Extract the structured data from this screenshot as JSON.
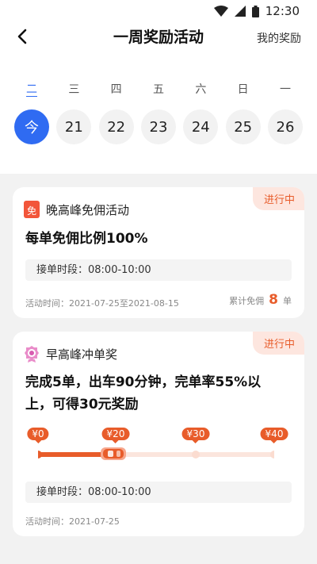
{
  "status": {
    "time": "12:30"
  },
  "nav": {
    "title": "一周奖励活动",
    "right_link": "我的奖励"
  },
  "week": {
    "days": [
      {
        "weekday": "二",
        "date": "今",
        "active": true
      },
      {
        "weekday": "三",
        "date": "21",
        "active": false
      },
      {
        "weekday": "四",
        "date": "22",
        "active": false
      },
      {
        "weekday": "五",
        "date": "23",
        "active": false
      },
      {
        "weekday": "六",
        "date": "24",
        "active": false
      },
      {
        "weekday": "日",
        "date": "25",
        "active": false
      },
      {
        "weekday": "一",
        "date": "26",
        "active": false
      }
    ]
  },
  "cards": [
    {
      "status": "进行中",
      "icon_char": "免",
      "title": "晚高峰免佣活动",
      "main": "每单免佣比例100%",
      "time_slot": "接单时段：08:00-10:00",
      "period": "活动时间：2021-07-25至2021-08-15",
      "summary_label": "累计免佣",
      "summary_value": "8",
      "summary_unit": "单"
    },
    {
      "status": "进行中",
      "title": "早高峰冲单奖",
      "main_line1": "完成5单，出车90分钟，完单率55%以",
      "main_line2": "上，可得30元奖励",
      "tiers": [
        "¥0",
        "¥20",
        "¥30",
        "¥40"
      ],
      "progress_tier_index": 1,
      "time_slot": "接单时段：08:00-10:00",
      "period": "活动时间：2021-07-25"
    }
  ],
  "colors": {
    "accent_blue": "#2f6bf2",
    "accent_orange": "#e85c2a",
    "badge_bg": "#fde6df",
    "track_bg": "#fbe5dd"
  }
}
